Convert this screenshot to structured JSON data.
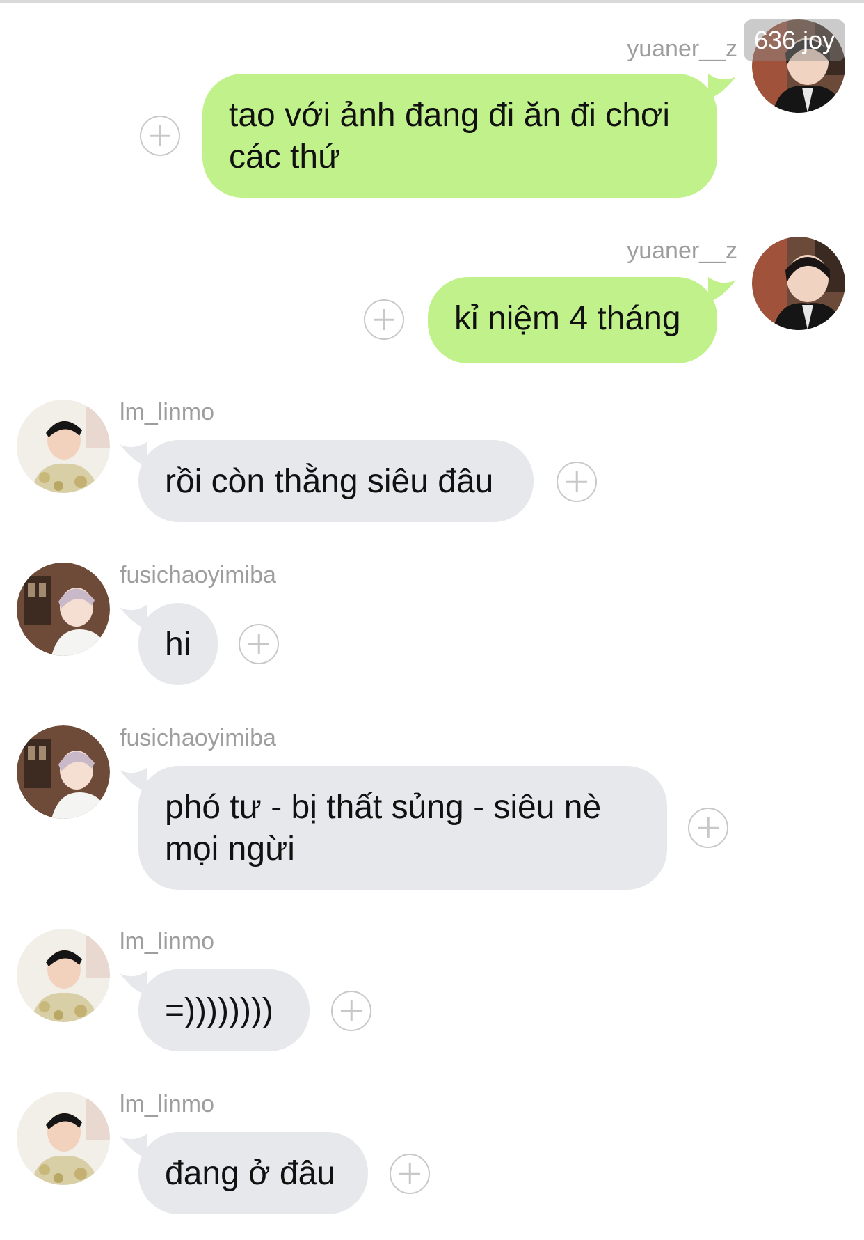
{
  "watermark": "636 joy",
  "colors": {
    "outgoing_bubble": "#c0f18a",
    "incoming_bubble": "#e6e8eb",
    "username": "#9e9e9e",
    "plus_icon": "#c8c8c8"
  },
  "messages": [
    {
      "direction": "outgoing",
      "username": "yuaner__z",
      "text": "tao với ảnh đang đi ăn đi chơi\ncác thứ",
      "avatar": "avatar-yuaner"
    },
    {
      "direction": "outgoing",
      "username": "yuaner__z",
      "text": "kỉ niệm 4 tháng",
      "avatar": "avatar-yuaner"
    },
    {
      "direction": "incoming",
      "username": "lm_linmo",
      "text": "rồi còn thằng siêu đâu",
      "avatar": "avatar-linmo"
    },
    {
      "direction": "incoming",
      "username": "fusichaoyimiba",
      "text": "hi",
      "avatar": "avatar-fusichao"
    },
    {
      "direction": "incoming",
      "username": "fusichaoyimiba",
      "text": "phó tư - bị thất sủng - siêu nè\nmọi ngừi",
      "avatar": "avatar-fusichao"
    },
    {
      "direction": "incoming",
      "username": "lm_linmo",
      "text": "=))))))))",
      "avatar": "avatar-linmo"
    },
    {
      "direction": "incoming",
      "username": "lm_linmo",
      "text": "đang ở đâu",
      "avatar": "avatar-linmo"
    }
  ],
  "icons": {
    "add_reaction": "plus-circle-icon"
  }
}
